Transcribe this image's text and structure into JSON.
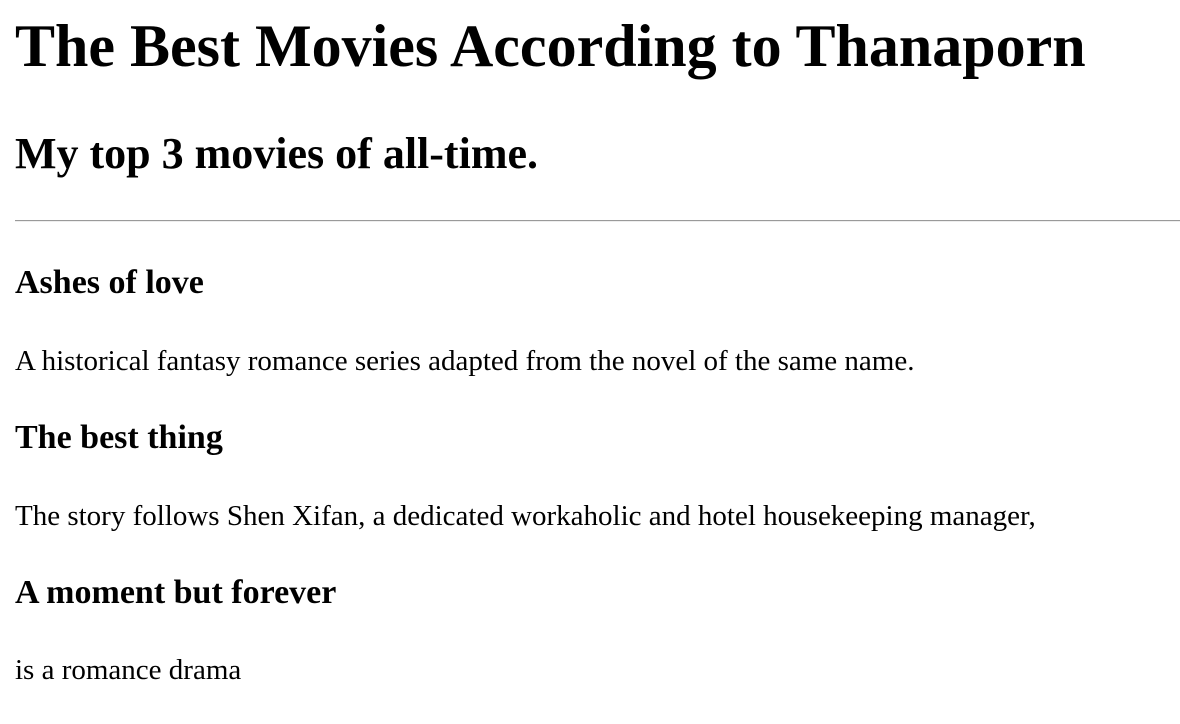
{
  "page": {
    "title": "The Best Movies According to Thanaporn",
    "subtitle": "My top 3 movies of all-time."
  },
  "movies": [
    {
      "title": "Ashes of love",
      "description": "A historical fantasy romance series adapted from the novel of the same name."
    },
    {
      "title": "The best thing",
      "description": "The story follows Shen Xifan, a dedicated workaholic and hotel housekeeping manager,"
    },
    {
      "title": "A moment but forever",
      "description": "is a romance drama"
    }
  ]
}
